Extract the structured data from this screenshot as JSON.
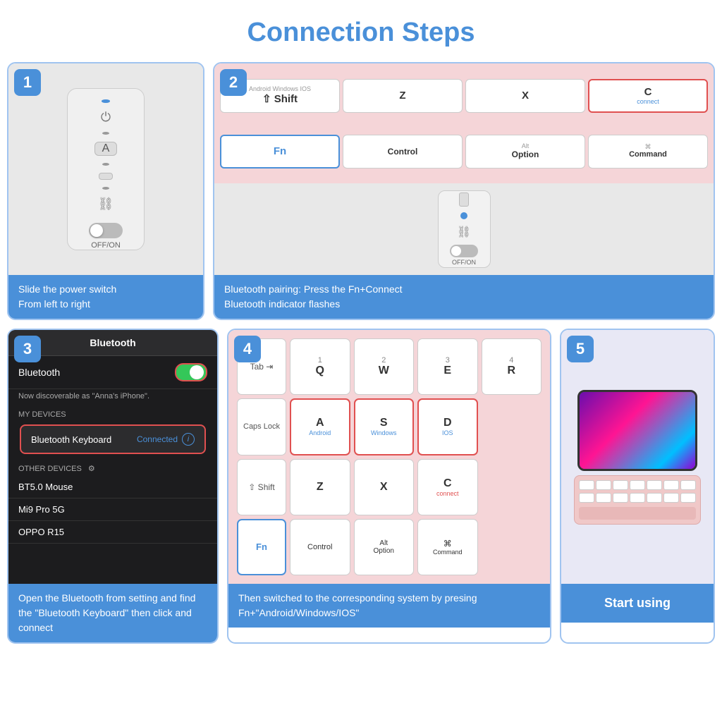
{
  "title": "Connection Steps",
  "steps": [
    {
      "number": "1",
      "caption": "Slide the power switch\nFrom left to right"
    },
    {
      "number": "2",
      "caption": "Bluetooth pairing: Press the Fn+Connect\nBluetooth indicator flashes"
    },
    {
      "number": "3",
      "caption": "Open the Bluetooth from setting and find the \"Bluetooth Keyboard\" then click and connect"
    },
    {
      "number": "4",
      "caption": "Then switched to the corresponding system by presing Fn+\"Android/Windows/IOS\""
    },
    {
      "number": "5",
      "caption": "Start using"
    }
  ],
  "step2_keys": [
    {
      "top": "Android  Windows  IOS",
      "main": "",
      "sub": ""
    },
    {
      "top": "",
      "main": "Z",
      "sub": ""
    },
    {
      "top": "",
      "main": "X",
      "sub": ""
    },
    {
      "top": "",
      "main": "C",
      "sub": "connect",
      "highlight": "red"
    },
    {
      "top": "",
      "main": "⇧ Shift",
      "sub": "",
      "small": true
    },
    {
      "top": "",
      "main": "Fn",
      "sub": "",
      "highlight": "blue"
    },
    {
      "top": "",
      "main": "Control",
      "sub": ""
    },
    {
      "top": "",
      "main": "Alt\nOption",
      "sub": ""
    },
    {
      "top": "",
      "main": "⌘\nCommand",
      "sub": ""
    }
  ],
  "bluetooth": {
    "header": "Bluetooth",
    "label": "Bluetooth",
    "discoverable": "Now discoverable as \"Anna's iPhone\".",
    "my_devices": "MY DEVICES",
    "keyboard_name": "Bluetooth Keyboard",
    "connected": "Connected",
    "other_devices": "OTHER DEVICES",
    "other1": "BT5.0 Mouse",
    "other2": "Mi9 Pro 5G",
    "other3": "OPPO R15"
  },
  "step4_keys": {
    "row1": [
      "1",
      "2",
      "3",
      "4"
    ],
    "row1_letters": [
      "Q",
      "W",
      "E",
      "R"
    ],
    "row2_letters": [
      "A",
      "S",
      "D"
    ],
    "row2_sub": [
      "Android",
      "Windows",
      "IOS"
    ],
    "row3_letters": [
      "Z",
      "X",
      "C"
    ],
    "row3_sub": [
      "",
      "",
      "connect"
    ],
    "row4": [
      "Alt",
      "Option",
      "⌘",
      "Command"
    ],
    "fn": "Fn",
    "control": "Control",
    "tab": "Tab ⇥",
    "caps": "Caps Lock",
    "shift": "⇧ Shift"
  },
  "icons": {
    "power": "⏻",
    "letter_a": "A",
    "document": "🗒",
    "link": "🔗",
    "toggle_off": "OFF/ON",
    "bluetooth_sym": "⚡"
  }
}
